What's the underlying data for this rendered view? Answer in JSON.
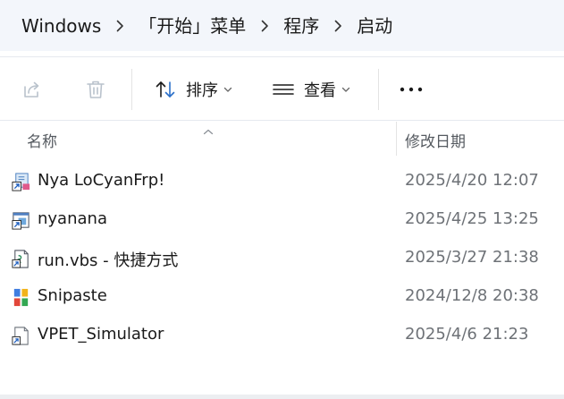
{
  "breadcrumb": {
    "items": [
      {
        "label": "Windows"
      },
      {
        "label": "「开始」菜单"
      },
      {
        "label": "程序"
      },
      {
        "label": "启动"
      }
    ]
  },
  "toolbar": {
    "sort_label": "排序",
    "view_label": "查看"
  },
  "columns": {
    "name": "名称",
    "date_modified": "修改日期"
  },
  "files": [
    {
      "name": "Nya LoCyanFrp!",
      "date": "2025/4/20 12:07",
      "icon": "app-shortcut-icon"
    },
    {
      "name": "nyanana",
      "date": "2025/4/25 13:25",
      "icon": "app-shortcut-icon"
    },
    {
      "name": "run.vbs - 快捷方式",
      "date": "2025/3/27 21:38",
      "icon": "script-shortcut-icon"
    },
    {
      "name": "Snipaste",
      "date": "2024/12/8 20:38",
      "icon": "snipaste-icon"
    },
    {
      "name": "VPET_Simulator",
      "date": "2025/4/6 21:23",
      "icon": "blank-shortcut-icon"
    }
  ],
  "colors": {
    "address_bar_bg": "#f3f6fb",
    "toolbar_icon": "#1a1a1a",
    "disabled_icon": "#b9c2cc",
    "accent_blue": "#2a6fc9"
  }
}
